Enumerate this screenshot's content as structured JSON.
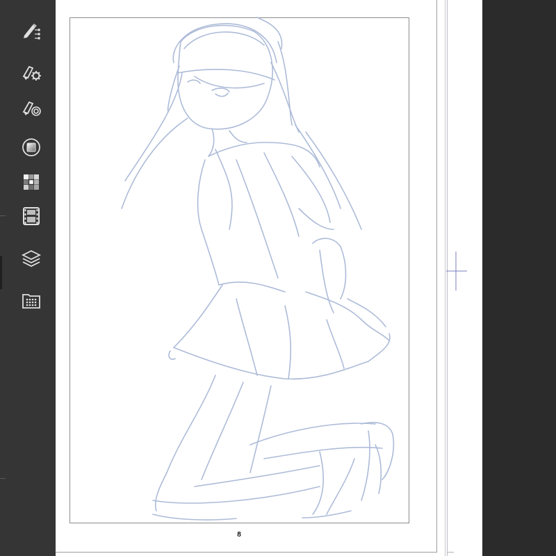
{
  "toolbar": {
    "tools": [
      {
        "name": "sub-tool-pen-icon"
      },
      {
        "name": "tool-property-icon"
      },
      {
        "name": "brush-size-icon"
      },
      {
        "name": "color-circle-icon"
      },
      {
        "name": "color-set-icon"
      },
      {
        "name": "animation-timeline-icon"
      },
      {
        "name": "layer-icon"
      },
      {
        "name": "material-folder-icon"
      }
    ]
  },
  "canvas": {
    "page_number": "8"
  },
  "colors": {
    "sketch_stroke": "#a9b8d6",
    "crosshair": "#7a7fb8"
  }
}
